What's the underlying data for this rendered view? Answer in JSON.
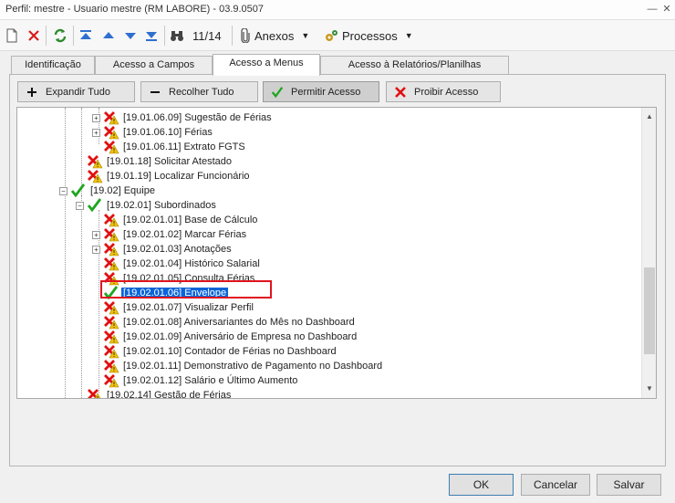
{
  "window": {
    "title": "Perfil: mestre - Usuario mestre (RM LABORE) - 03.9.0507"
  },
  "toolbar": {
    "record_counter": "11/14",
    "attachments_label": "Anexos",
    "processes_label": "Processos"
  },
  "tabs": [
    {
      "label": "Identificação"
    },
    {
      "label": "Acesso a Campos"
    },
    {
      "label": "Acesso a Menus"
    },
    {
      "label": "Acesso à Relatórios/Planilhas"
    }
  ],
  "actions": {
    "expand_all": "Expandir Tudo",
    "collapse_all": "Recolher Tudo",
    "allow": "Permitir Acesso",
    "deny": "Proibir Acesso"
  },
  "tree": [
    {
      "label": "[19.01.06.09] Sugestão de Férias",
      "status": "denied",
      "expandable": true
    },
    {
      "label": "[19.01.06.10] Férias",
      "status": "denied",
      "expandable": true
    },
    {
      "label": "[19.01.06.11] Extrato FGTS",
      "status": "denied",
      "expandable": false
    },
    {
      "label": "[19.01.18] Solicitar Atestado",
      "status": "denied",
      "expandable": false
    },
    {
      "label": "[19.01.19] Localizar Funcionário",
      "status": "denied",
      "expandable": false
    },
    {
      "label": "[19.02] Equipe",
      "status": "allowed",
      "expandable": true
    },
    {
      "label": "[19.02.01] Subordinados",
      "status": "allowed",
      "expandable": true
    },
    {
      "label": "[19.02.01.01] Base de Cálculo",
      "status": "denied",
      "expandable": false
    },
    {
      "label": "[19.02.01.02] Marcar Férias",
      "status": "denied",
      "expandable": true
    },
    {
      "label": "[19.02.01.03] Anotações",
      "status": "denied",
      "expandable": true
    },
    {
      "label": "[19.02.01.04] Histórico Salarial",
      "status": "denied",
      "expandable": false
    },
    {
      "label": "[19.02.01.05] Consulta Férias",
      "status": "denied",
      "expandable": false
    },
    {
      "label": "[19.02.01.06] Envelope",
      "status": "allowed",
      "expandable": false,
      "selected": true
    },
    {
      "label": "[19.02.01.07] Visualizar Perfil",
      "status": "denied",
      "expandable": false
    },
    {
      "label": "[19.02.01.08] Aniversariantes do Mês no Dashboard",
      "status": "denied",
      "expandable": false
    },
    {
      "label": "[19.02.01.09] Aniversário de Empresa no Dashboard",
      "status": "denied",
      "expandable": false
    },
    {
      "label": "[19.02.01.10] Contador de Férias no Dashboard",
      "status": "denied",
      "expandable": false
    },
    {
      "label": "[19.02.01.11] Demonstrativo de Pagamento no Dashboard",
      "status": "denied",
      "expandable": false
    },
    {
      "label": "[19.02.01.12] Salário e Último Aumento",
      "status": "denied",
      "expandable": false
    },
    {
      "label": "[19.02.14] Gestão de Férias",
      "status": "denied",
      "expandable": false
    }
  ],
  "footer": {
    "ok": "OK",
    "cancel": "Cancelar",
    "save": "Salvar"
  },
  "colors": {
    "selection": "#0a64d8",
    "highlight": "#e0141e",
    "allowed": "#1fa51f",
    "denied": "#e01010",
    "warning": "#f2c200"
  }
}
